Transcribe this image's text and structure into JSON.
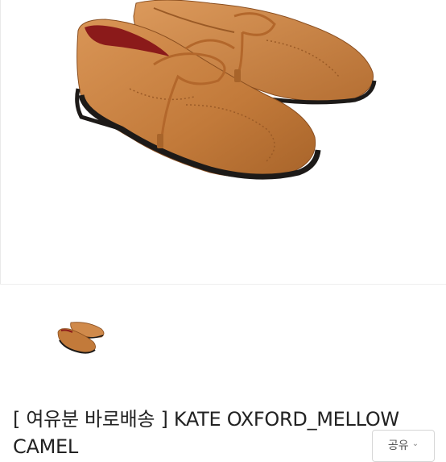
{
  "product": {
    "title": "[ 여유분 바로배송 ] KATE OXFORD_MELLOW CAMEL",
    "main_image_icon": "camel-oxford-shoes-image",
    "thumbnail_icon": "camel-oxford-shoes-thumbnail"
  },
  "actions": {
    "share_label": "공유",
    "share_icon": "chevron-down-icon"
  },
  "colors": {
    "leather": "#c27a3a",
    "leather_dark": "#8a4e1f",
    "lining": "#8b1a1a",
    "sole": "#1d1a18"
  }
}
